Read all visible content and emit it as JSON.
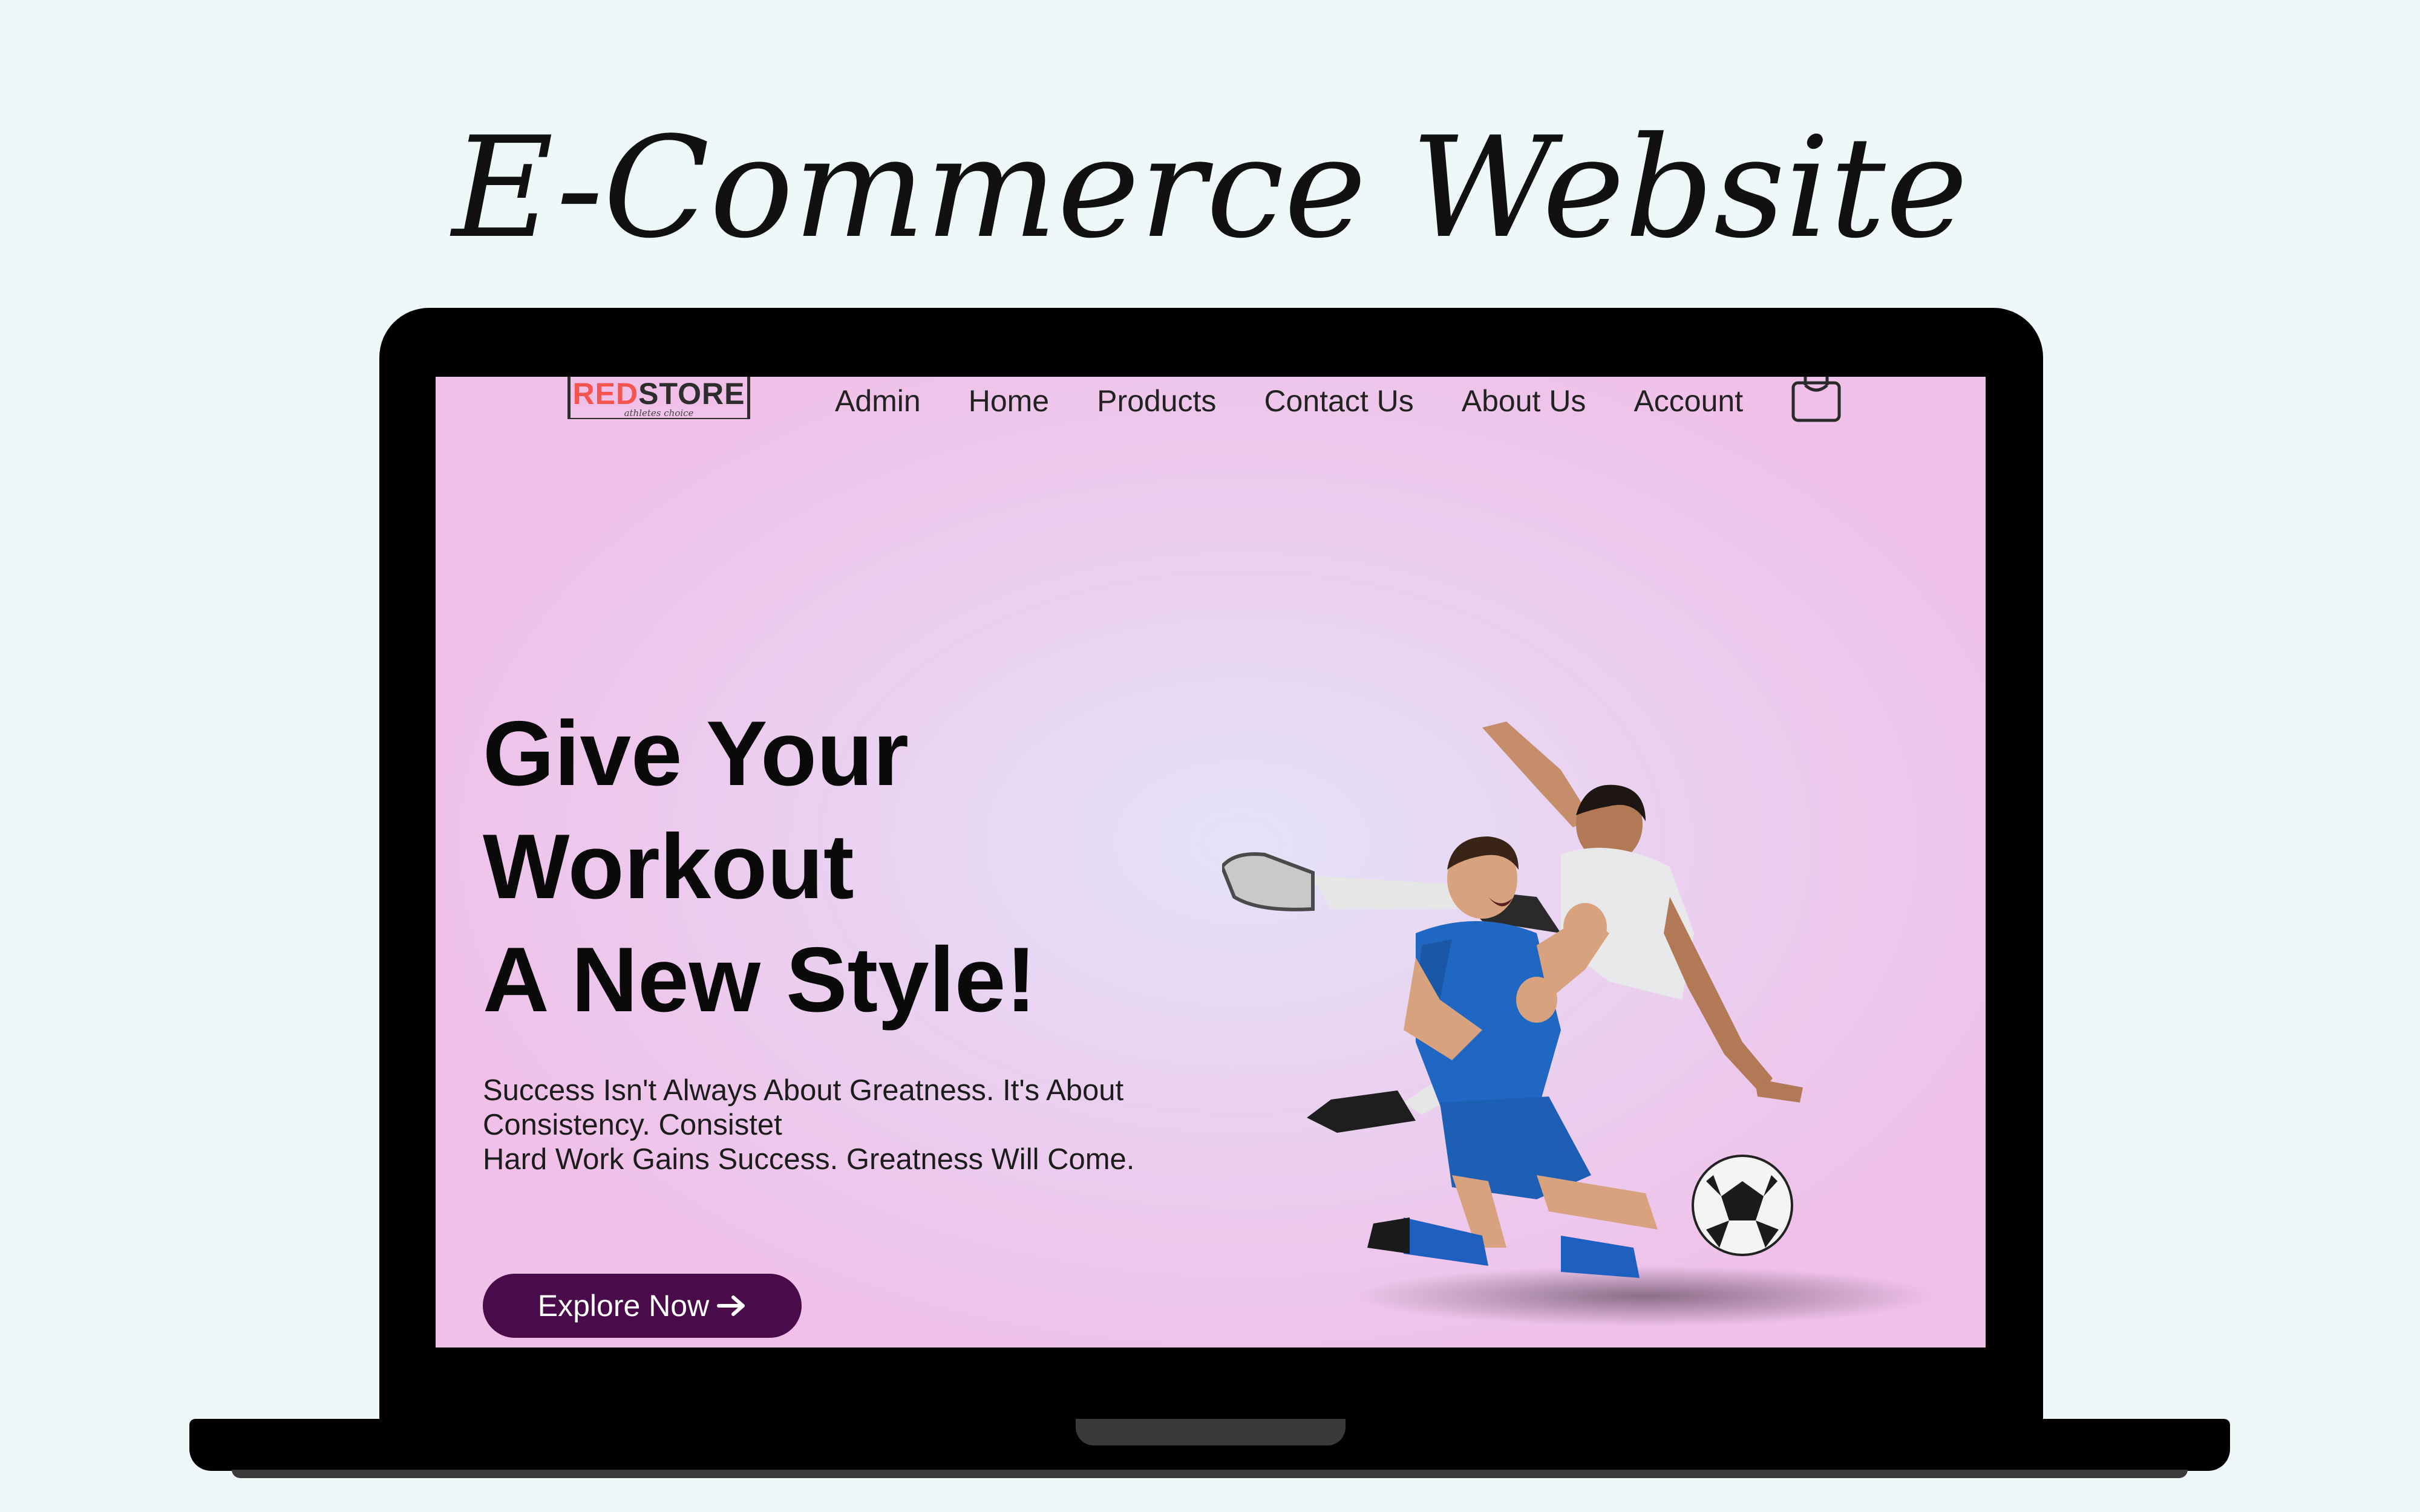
{
  "presentation": {
    "headline": "E-Commerce Website",
    "background_color": "#eff8f9"
  },
  "header": {
    "logo": {
      "word_red": "RED",
      "word_dark": "STORE",
      "tagline": "athletes choice",
      "colors": {
        "red": "#f5544f",
        "dark": "#2d2d2d"
      }
    },
    "nav": {
      "items": [
        {
          "label": "Admin"
        },
        {
          "label": "Home"
        },
        {
          "label": "Products"
        },
        {
          "label": "Contact Us"
        },
        {
          "label": "About Us"
        },
        {
          "label": "Account"
        }
      ]
    },
    "cart_icon": "shopping-bag-icon"
  },
  "hero": {
    "title_lines": [
      "Give Your",
      "Workout",
      "A New Style!"
    ],
    "description_lines": [
      "Success Isn't Always About Greatness. It's About",
      "Consistency. Consistet",
      "Hard Work Gains Success. Greatness Will Come."
    ],
    "cta": {
      "label": "Explore Now",
      "icon": "arrow-right-icon",
      "color": "#4a0b4a"
    },
    "image": "two-soccer-players-illustration",
    "gradient_colors": [
      "#e4e3f8",
      "#ead2f0",
      "#f0c0e9"
    ]
  }
}
